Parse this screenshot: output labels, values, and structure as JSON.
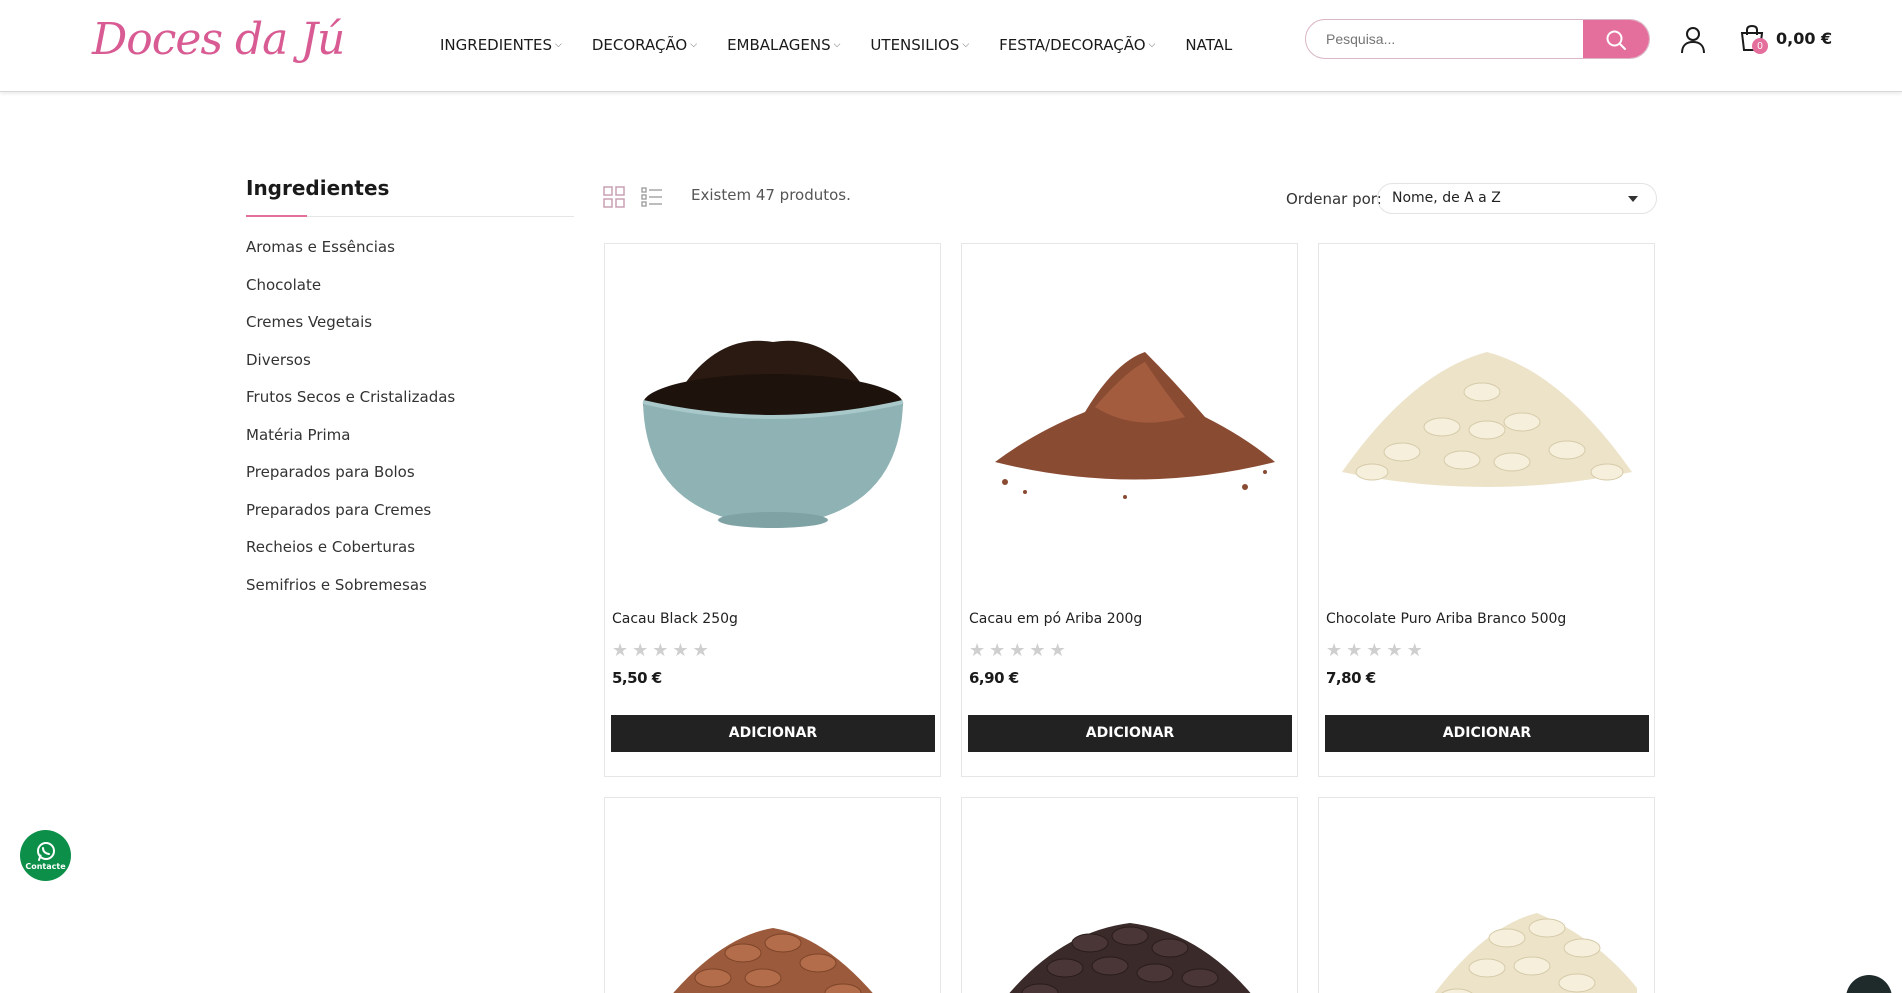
{
  "header": {
    "logo_text": "Doces da Jú",
    "nav": [
      {
        "label": "INGREDIENTES",
        "has_dropdown": true
      },
      {
        "label": "DECORAÇÃO",
        "has_dropdown": true
      },
      {
        "label": "EMBALAGENS",
        "has_dropdown": true
      },
      {
        "label": "UTENSILIOS",
        "has_dropdown": true
      },
      {
        "label": "FESTA/DECORAÇÃO",
        "has_dropdown": true
      },
      {
        "label": "NATAL",
        "has_dropdown": false
      }
    ],
    "search_placeholder": "Pesquisa...",
    "cart_count": "0",
    "cart_total": "0,00 €"
  },
  "sidebar": {
    "title": "Ingredientes",
    "items": [
      "Aromas e Essências",
      "Chocolate",
      "Cremes Vegetais",
      "Diversos",
      "Frutos Secos e Cristalizadas",
      "Matéria Prima",
      "Preparados para Bolos",
      "Preparados para Cremes",
      "Recheios e Coberturas",
      "Semifrios e Sobremesas"
    ]
  },
  "toolbar": {
    "count_text": "Existem 47 produtos.",
    "sort_label": "Ordenar por:",
    "sort_value": "Nome, de A a Z"
  },
  "products": [
    {
      "name": "Cacau Black 250g",
      "price": "5,50 €",
      "rating": 0,
      "button": "ADICIONAR",
      "image": "cocoa-bowl-image"
    },
    {
      "name": "Cacau em pó Ariba 200g",
      "price": "6,90 €",
      "rating": 0,
      "button": "ADICIONAR",
      "image": "cocoa-powder-image"
    },
    {
      "name": "Chocolate Puro Ariba Branco 500g",
      "price": "7,80 €",
      "rating": 0,
      "button": "ADICIONAR",
      "image": "white-chocolate-image"
    },
    {
      "name": "",
      "price": "",
      "rating": 0,
      "button": "",
      "image": "milk-chocolate-image"
    },
    {
      "name": "",
      "price": "",
      "rating": 0,
      "button": "",
      "image": "dark-chocolate-image"
    },
    {
      "name": "",
      "price": "",
      "rating": 0,
      "button": "",
      "image": "white-chocolate-image"
    }
  ],
  "floating": {
    "whatsapp_label": "Contacte"
  },
  "colors": {
    "accent": "#e46f9c",
    "button": "#222222",
    "whatsapp": "#0c8f49"
  }
}
